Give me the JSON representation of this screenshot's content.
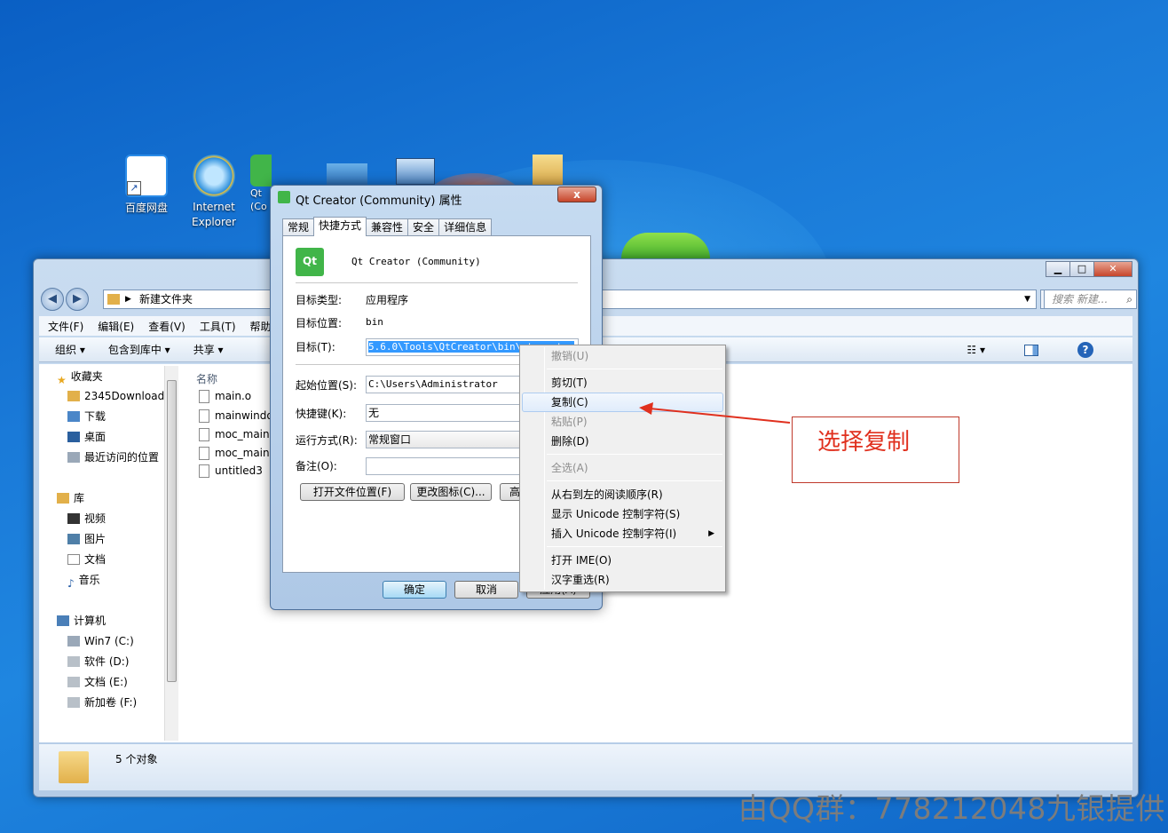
{
  "desktop": {
    "icons": [
      {
        "label": "百度网盘"
      },
      {
        "label": "Internet Explorer"
      },
      {
        "label": "Qt (Co"
      }
    ]
  },
  "explorer": {
    "breadcrumb": "新建文件夹",
    "search_placeholder": "搜索 新建...",
    "menu": [
      "文件(F)",
      "编辑(E)",
      "查看(V)",
      "工具(T)",
      "帮助("
    ],
    "toolbar": {
      "organize": "组织 ▾",
      "include": "包含到库中 ▾",
      "share": "共享 ▾"
    },
    "column_name": "名称",
    "nav": {
      "favorites": "收藏夹",
      "fav_items": [
        "2345Download",
        "下载",
        "桌面",
        "最近访问的位置"
      ],
      "libraries": "库",
      "lib_items": [
        "视频",
        "图片",
        "文档",
        "音乐"
      ],
      "computer": "计算机",
      "drives": [
        "Win7 (C:)",
        "软件 (D:)",
        "文档 (E:)",
        "新加卷 (F:)"
      ]
    },
    "files": [
      "main.o",
      "mainwindo",
      "moc_mainv",
      "moc_mainv",
      "untitled3"
    ],
    "status": "5 个对象"
  },
  "dialog": {
    "title": "Qt Creator (Community) 属性",
    "close": "x",
    "tabs": [
      "常规",
      "快捷方式",
      "兼容性",
      "安全",
      "详细信息"
    ],
    "app_name": "Qt Creator (Community)",
    "app_icon_text": "Qt",
    "target_type_label": "目标类型:",
    "target_type": "应用程序",
    "target_loc_label": "目标位置:",
    "target_loc": "bin",
    "target_label": "目标(T):",
    "target_value": "5.6.0\\Tools\\QtCreator\\bin\\qtcreator",
    "start_label": "起始位置(S):",
    "start_value": "C:\\Users\\Administrator",
    "hotkey_label": "快捷键(K):",
    "hotkey_value": "无",
    "run_label": "运行方式(R):",
    "run_value": "常规窗口",
    "comment_label": "备注(O):",
    "comment_value": "",
    "btn_open_loc": "打开文件位置(F)",
    "btn_change_icon": "更改图标(C)...",
    "btn_advanced": "高",
    "ok": "确定",
    "cancel": "取消",
    "apply": "应用(A)"
  },
  "context_menu": [
    {
      "label": "撤销(U)",
      "state": "disabled"
    },
    {
      "label": "剪切(T)",
      "state": "normal"
    },
    {
      "label": "复制(C)",
      "state": "hover"
    },
    {
      "label": "粘贴(P)",
      "state": "disabled"
    },
    {
      "label": "删除(D)",
      "state": "normal"
    },
    {
      "label": "全选(A)",
      "state": "disabled"
    },
    {
      "label": "从右到左的阅读顺序(R)",
      "state": "normal"
    },
    {
      "label": "显示 Unicode 控制字符(S)",
      "state": "normal"
    },
    {
      "label": "插入 Unicode 控制字符(I)",
      "state": "normal"
    },
    {
      "label": "打开 IME(O)",
      "state": "normal"
    },
    {
      "label": "汉字重选(R)",
      "state": "normal"
    }
  ],
  "annotation": "选择复制",
  "watermark": "由QQ群：778212048九银提供",
  "colors": {
    "accent": "#3399ff",
    "annotation_red": "#e0301e",
    "qt_green": "#41b549"
  }
}
